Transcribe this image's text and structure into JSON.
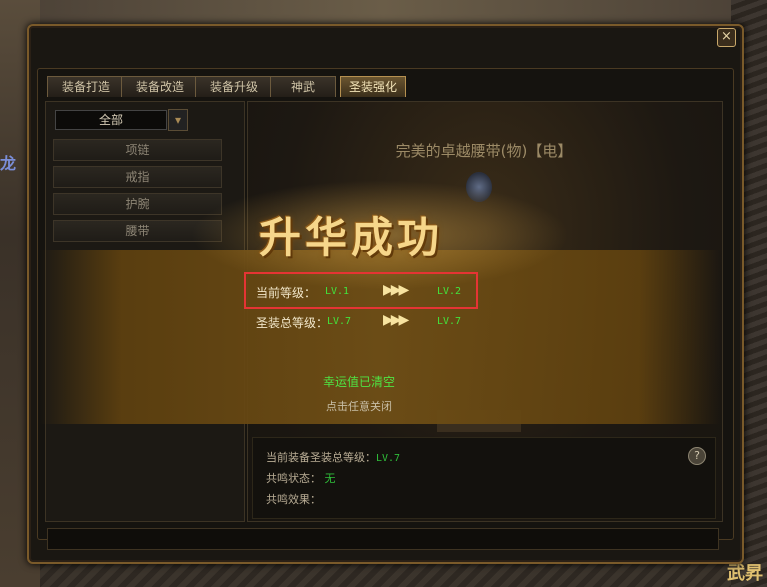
{
  "tabs": [
    "装备打造",
    "装备改造",
    "装备升级",
    "神武",
    "圣装强化"
  ],
  "active_tab": "圣装强化",
  "filter": {
    "selected": "全部"
  },
  "categories": [
    "项链",
    "戒指",
    "护腕",
    "腰带"
  ],
  "item": {
    "name": "完美的卓越腰带(物)【电】"
  },
  "overlay": {
    "title": "升华成功",
    "current_level_label": "当前等级：",
    "current_level_from": "LV.1",
    "current_level_to": "LV.2",
    "set_level_label": "圣装总等级：",
    "set_level_from": "LV.7",
    "set_level_to": "LV.7",
    "arrows": "▶▶▶",
    "luck_message": "幸运值已清空",
    "close_hint": "点击任意关闭"
  },
  "info": {
    "set_total_label": "当前装备圣装总等级：",
    "set_total_value": "LV.7",
    "resonance_status_label": "共鸣状态：",
    "resonance_status_value": "无",
    "resonance_effect_label": "共鸣效果："
  },
  "close_button": "×",
  "help": "?",
  "background_text": {
    "corner": "武昇"
  }
}
